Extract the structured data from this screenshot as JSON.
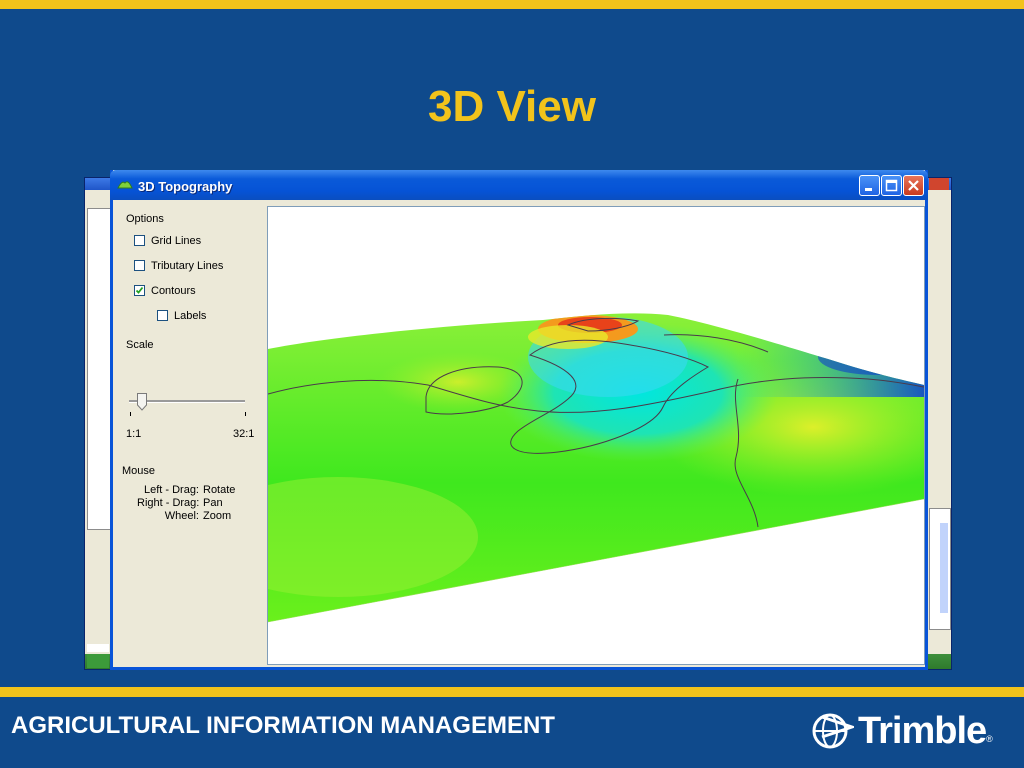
{
  "slide": {
    "title": "3D View",
    "footer": "AGRICULTURAL INFORMATION MANAGEMENT",
    "logo_text": "Trimble",
    "logo_mark": "®"
  },
  "colors": {
    "background": "#0f4a8c",
    "accent_gold": "#f2c31b",
    "titlebar_blue": "#0653d6"
  },
  "dialog": {
    "title": "3D Topography",
    "title_icon": "terrain-icon",
    "options": {
      "heading": "Options",
      "grid_lines": {
        "label": "Grid Lines",
        "checked": false
      },
      "tributary_lines": {
        "label": "Tributary Lines",
        "checked": false
      },
      "contours": {
        "label": "Contours",
        "checked": true
      },
      "labels": {
        "label": "Labels",
        "checked": false
      }
    },
    "scale": {
      "heading": "Scale",
      "min_label": "1:1",
      "max_label": "32:1",
      "value_label": "1:1"
    },
    "mouse": {
      "heading": "Mouse",
      "rows": [
        {
          "action": "Left - Drag:",
          "effect": "Rotate"
        },
        {
          "action": "Right - Drag:",
          "effect": "Pan"
        },
        {
          "action": "Wheel:",
          "effect": "Zoom"
        }
      ]
    }
  }
}
